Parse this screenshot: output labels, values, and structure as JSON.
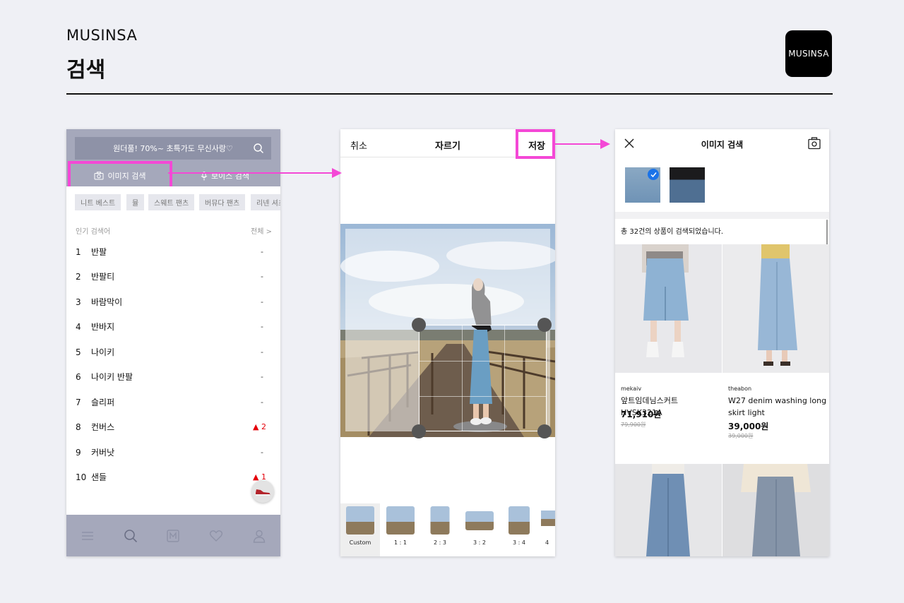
{
  "header": {
    "brand": "MUSINSA",
    "title": "검색",
    "logo_text": "MUSINSA"
  },
  "screen1": {
    "search_placeholder": "원더풀! 70%~ 초특가도 무신사랑♡",
    "tab_image_search": "이미지 검색",
    "tab_voice_search": "보이스 검색",
    "chips": [
      "니트 베스트",
      "뮬",
      "스웨트 팬츠",
      "버뮤다 팬츠",
      "리넨 셔츠"
    ],
    "popular_label": "인기 검색어",
    "popular_all": "전체 >",
    "ranks": [
      {
        "num": "1",
        "keyword": "반팔",
        "change": "-"
      },
      {
        "num": "2",
        "keyword": "반팔티",
        "change": "-"
      },
      {
        "num": "3",
        "keyword": "바람막이",
        "change": "-"
      },
      {
        "num": "4",
        "keyword": "반바지",
        "change": "-"
      },
      {
        "num": "5",
        "keyword": "나이키",
        "change": "-"
      },
      {
        "num": "6",
        "keyword": "나이키 반팔",
        "change": "-"
      },
      {
        "num": "7",
        "keyword": "슬리퍼",
        "change": "-"
      },
      {
        "num": "8",
        "keyword": "컨버스",
        "change": "▲ 2"
      },
      {
        "num": "9",
        "keyword": "커버낫",
        "change": "-"
      },
      {
        "num": "10",
        "keyword": "샌들",
        "change": "▲ 1"
      }
    ],
    "nav": [
      "menu-icon",
      "search-icon",
      "musinsa-m-icon",
      "heart-icon",
      "person-icon"
    ]
  },
  "screen2": {
    "cancel": "취소",
    "title": "자르기",
    "save": "저장",
    "ratios": [
      "Custom",
      "1 : 1",
      "2 : 3",
      "3 : 2",
      "3 : 4",
      "4"
    ]
  },
  "screen3": {
    "title": "이미지 검색",
    "result_count": "총 32건의 상품이 검색되었습니다.",
    "products": [
      {
        "brand": "mekaiv",
        "name": "앞트임데님스커트 HVSK321A",
        "price": "71,910원",
        "original": "79,900원"
      },
      {
        "brand": "theabon",
        "name": "W27 denim washing long skirt  light",
        "price": "39,000원",
        "original": "39,000원"
      }
    ]
  },
  "colors": {
    "highlight": "#f448d6",
    "header_gray": "#a5a8bb",
    "rank_up": "#e5000a",
    "check_blue": "#1a73e8"
  }
}
